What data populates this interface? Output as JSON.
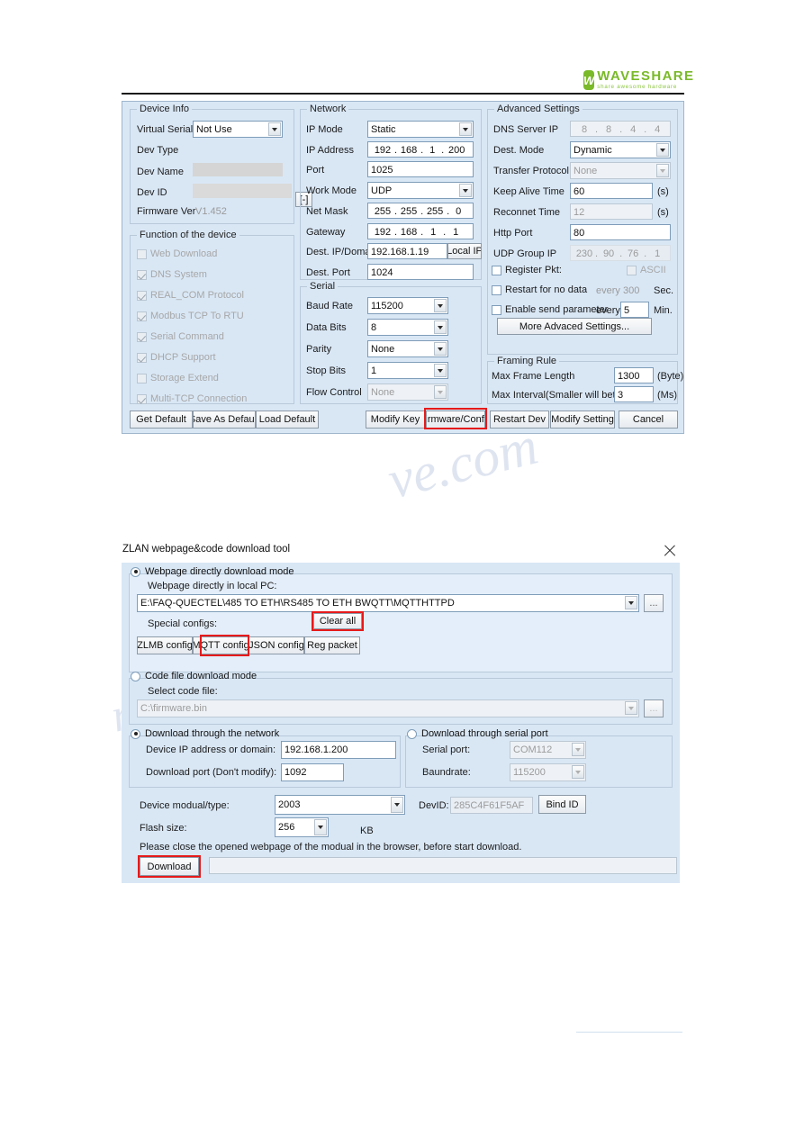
{
  "brand": {
    "name": "WAVESHARE",
    "tagline": "share awesome hardware",
    "mark": "W",
    "color": "#7ab929"
  },
  "watermarks": {
    "line1": "ve.com",
    "line2": "manualarchive"
  },
  "config_dialog": {
    "device_info": {
      "legend": "Device Info",
      "fields": [
        {
          "label": "Virtual Serial",
          "value": "Not Use",
          "type": "combo"
        },
        {
          "label": "Dev Type",
          "value": "",
          "type": "text"
        },
        {
          "label": "Dev Name",
          "value": "",
          "type": "redacted"
        },
        {
          "label": "Dev ID",
          "value": "",
          "type": "redacted"
        },
        {
          "label": "Firmware Ver",
          "value": "V1.452",
          "type": "static"
        }
      ],
      "expand_button": "[-]"
    },
    "functions": {
      "legend": "Function of the device",
      "items": [
        {
          "label": "Web Download",
          "checked": false
        },
        {
          "label": "DNS System",
          "checked": true
        },
        {
          "label": "REAL_COM Protocol",
          "checked": true
        },
        {
          "label": "Modbus TCP To RTU",
          "checked": true
        },
        {
          "label": "Serial Command",
          "checked": true
        },
        {
          "label": "DHCP Support",
          "checked": true
        },
        {
          "label": "Storage Extend",
          "checked": false
        },
        {
          "label": "Multi-TCP Connection",
          "checked": true
        }
      ]
    },
    "network": {
      "legend": "Network",
      "ip_mode_label": "IP Mode",
      "ip_mode_value": "Static",
      "ip_address_label": "IP Address",
      "ip_address_octets": [
        "192",
        "168",
        "1",
        "200"
      ],
      "port_label": "Port",
      "port_value": "1025",
      "work_mode_label": "Work Mode",
      "work_mode_value": "UDP",
      "net_mask_label": "Net Mask",
      "net_mask_octets": [
        "255",
        "255",
        "255",
        "0"
      ],
      "gateway_label": "Gateway",
      "gateway_octets": [
        "192",
        "168",
        "1",
        "1"
      ],
      "dest_ip_label": "Dest. IP/Domain",
      "dest_ip_value": "192.168.1.19",
      "local_ip_button": "Local IP",
      "dest_port_label": "Dest. Port",
      "dest_port_value": "1024"
    },
    "serial": {
      "legend": "Serial",
      "fields": [
        {
          "label": "Baud Rate",
          "value": "115200",
          "disabled": false
        },
        {
          "label": "Data Bits",
          "value": "8",
          "disabled": false
        },
        {
          "label": "Parity",
          "value": "None",
          "disabled": false
        },
        {
          "label": "Stop Bits",
          "value": "1",
          "disabled": false
        },
        {
          "label": "Flow Control",
          "value": "None",
          "disabled": true
        }
      ]
    },
    "advanced": {
      "legend": "Advanced Settings",
      "dns_label": "DNS Server IP",
      "dns_octets": [
        "8",
        "8",
        "4",
        "4"
      ],
      "dest_mode_label": "Dest. Mode",
      "dest_mode_value": "Dynamic",
      "transfer_protocol_label": "Transfer Protocol",
      "transfer_protocol_value": "None",
      "keep_alive_label": "Keep Alive Time",
      "keep_alive_value": "60",
      "keep_alive_unit": "(s)",
      "reconnet_label": "Reconnet Time",
      "reconnet_value": "12",
      "reconnet_unit": "(s)",
      "http_port_label": "Http Port",
      "http_port_value": "80",
      "udp_group_label": "UDP Group IP",
      "udp_group_octets": [
        "230",
        "90",
        "76",
        "1"
      ],
      "register_pkt_label": "Register Pkt:",
      "register_pkt_checked": false,
      "ascii_label": "ASCII",
      "ascii_checked": false,
      "restart_label": "Restart for no data",
      "restart_checked": false,
      "restart_every": "every",
      "restart_value": "300",
      "restart_unit": "Sec.",
      "send_param_label": "Enable send parameter",
      "send_param_checked": false,
      "send_param_every": "every",
      "send_param_value": "5",
      "send_param_unit": "Min.",
      "more_button": "More Advaced Settings..."
    },
    "framing": {
      "legend": "Framing Rule",
      "max_frame_label": "Max Frame Length",
      "max_frame_value": "1300",
      "max_frame_unit": "(Byte)",
      "max_interval_label": "Max Interval(Smaller will better)",
      "max_interval_value": "3",
      "max_interval_unit": "(Ms)"
    },
    "buttons": {
      "get_default": "Get Default",
      "save_as_default": "Save As Default",
      "load_default": "Load Default",
      "modify_key": "Modify Key",
      "firmware_config": "Firmware/Config",
      "restart_dev": "Restart Dev",
      "modify_setting": "Modify Setting",
      "cancel": "Cancel"
    }
  },
  "download_tool": {
    "title": "ZLAN webpage&code download tool",
    "webpage_mode": {
      "radio_label": "Webpage directly download mode",
      "selected": true,
      "path_label": "Webpage directly in local PC:",
      "path_value": "E:\\FAQ-QUECTEL\\485 TO ETH\\RS485 TO ETH BWQTT\\MQTTHTTPD",
      "browse_button": "...",
      "special_configs_label": "Special configs:",
      "clear_all_button": "Clear all",
      "config_buttons": [
        "ZLMB config",
        "MQTT config",
        "JSON config",
        "Reg packet"
      ]
    },
    "code_mode": {
      "radio_label": "Code file download mode",
      "selected": false,
      "select_label": "Select code file:",
      "file_value": "C:\\firmware.bin",
      "browse_button": "..."
    },
    "network_mode": {
      "radio_label": "Download through the network",
      "selected": true,
      "ip_label": "Device IP address or domain:",
      "ip_value": "192.168.1.200",
      "port_label": "Download port (Don't modify):",
      "port_value": "1092"
    },
    "serial_mode": {
      "radio_label": "Download through serial port",
      "selected": false,
      "port_label": "Serial port:",
      "port_value": "COM112",
      "baud_label": "Baundrate:",
      "baud_value": "115200"
    },
    "bottom": {
      "module_label": "Device modual/type:",
      "module_value": "2003",
      "flash_label": "Flash size:",
      "flash_value": "256",
      "flash_unit": "KB",
      "devid_label": "DevID:",
      "devid_value": "285C4F61F5AF",
      "bind_button": "Bind ID",
      "note": "Please close the opened webpage of the modual in the browser, before start download.",
      "download_button": "Download"
    }
  }
}
